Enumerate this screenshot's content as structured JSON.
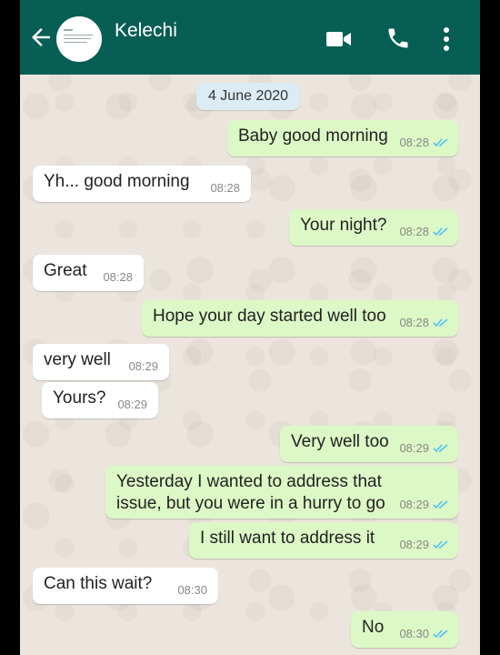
{
  "header": {
    "contact_name": "Kelechi",
    "icons": [
      "back-arrow-icon",
      "video-call-icon",
      "voice-call-icon",
      "more-options-icon"
    ],
    "color": "#075e54"
  },
  "date_chip": "4 June 2020",
  "messages": [
    {
      "dir": "out",
      "text": "Baby good morning",
      "time": "08:28",
      "status": "read"
    },
    {
      "dir": "in",
      "text": "Yh... good morning",
      "time": "08:28"
    },
    {
      "dir": "out",
      "text": "Your night?",
      "time": "08:28",
      "status": "read"
    },
    {
      "dir": "in",
      "text": "Great",
      "time": "08:28"
    },
    {
      "dir": "out",
      "text": "Hope your day started well too",
      "time": "08:28",
      "status": "read"
    },
    {
      "dir": "in",
      "text": "very well",
      "time": "08:29"
    },
    {
      "dir": "in",
      "text": "Yours?",
      "time": "08:29"
    },
    {
      "dir": "out",
      "text": "Very well too",
      "time": "08:29",
      "status": "read"
    },
    {
      "dir": "out",
      "text": "Yesterday I wanted to address that issue, but you were in a hurry to go",
      "time": "08:29",
      "status": "read"
    },
    {
      "dir": "out",
      "text": "I still want to address it",
      "time": "08:29",
      "status": "read"
    },
    {
      "dir": "in",
      "text": "Can this wait?",
      "time": "08:30"
    },
    {
      "dir": "out",
      "text": "No",
      "time": "08:30",
      "status": "read"
    }
  ],
  "colors": {
    "outgoing": "#dcf8c6",
    "incoming": "#ffffff",
    "read_ticks": "#4fc3f7"
  }
}
